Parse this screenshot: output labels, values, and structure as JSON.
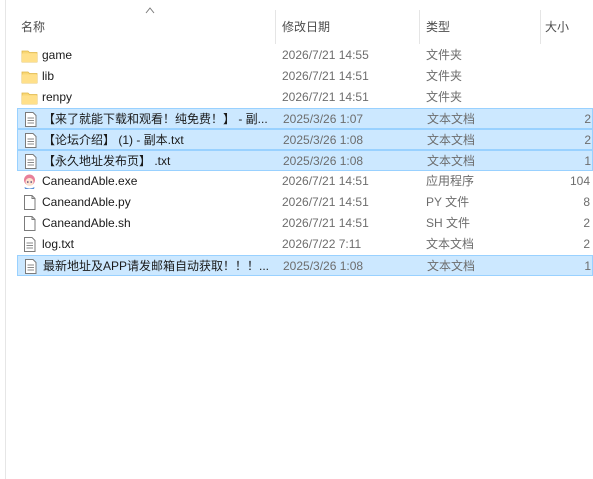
{
  "columns": {
    "name": "名称",
    "date": "修改日期",
    "type": "类型",
    "size": "大小"
  },
  "files": [
    {
      "icon": "folder-icon",
      "name": "game",
      "date": "2026/7/21 14:55",
      "type": "文件夹",
      "size": "",
      "selected": false
    },
    {
      "icon": "folder-icon",
      "name": "lib",
      "date": "2026/7/21 14:51",
      "type": "文件夹",
      "size": "",
      "selected": false
    },
    {
      "icon": "folder-icon",
      "name": "renpy",
      "date": "2026/7/21 14:51",
      "type": "文件夹",
      "size": "",
      "selected": false
    },
    {
      "icon": "text-document-icon",
      "name": "【来了就能下载和观看！纯免费！】 - 副...",
      "date": "2025/3/26 1:07",
      "type": "文本文档",
      "size": "2",
      "selected": true
    },
    {
      "icon": "text-document-icon",
      "name": "【论坛介绍】 (1) - 副本.txt",
      "date": "2025/3/26 1:08",
      "type": "文本文档",
      "size": "2",
      "selected": true
    },
    {
      "icon": "text-document-icon",
      "name": "【永久地址发布页】 .txt",
      "date": "2025/3/26 1:08",
      "type": "文本文档",
      "size": "1",
      "selected": true
    },
    {
      "icon": "app-exe-icon",
      "name": "CaneandAble.exe",
      "date": "2026/7/21 14:51",
      "type": "应用程序",
      "size": "104",
      "selected": false
    },
    {
      "icon": "blank-file-icon",
      "name": "CaneandAble.py",
      "date": "2026/7/21 14:51",
      "type": "PY 文件",
      "size": "8",
      "selected": false
    },
    {
      "icon": "blank-file-icon",
      "name": "CaneandAble.sh",
      "date": "2026/7/21 14:51",
      "type": "SH 文件",
      "size": "2",
      "selected": false
    },
    {
      "icon": "text-document-icon",
      "name": "log.txt",
      "date": "2026/7/22 7:11",
      "type": "文本文档",
      "size": "2",
      "selected": false
    },
    {
      "icon": "text-document-icon",
      "name": "最新地址及APP请发邮箱自动获取！！！...",
      "date": "2025/3/26 1:08",
      "type": "文本文档",
      "size": "1",
      "selected": true
    }
  ],
  "colors": {
    "selection": "#cce8ff",
    "selection_border": "#99d1ff",
    "folder": "#f8d775"
  }
}
